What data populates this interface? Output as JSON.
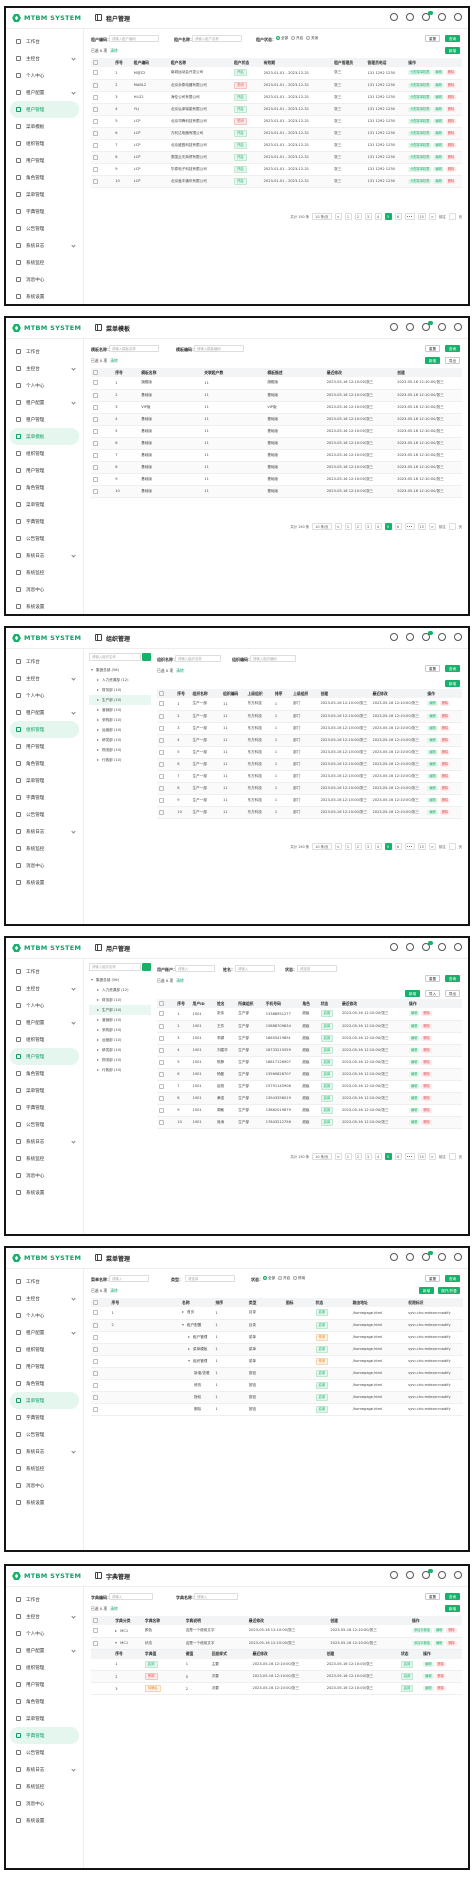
{
  "brand": "MTBM SYSTEM",
  "colors": {
    "accent": "#17b26a",
    "danger": "#e5484d",
    "active_bg": "#e5f6ee"
  },
  "sidebars": {
    "tenant_menu": [
      {
        "label": "工作台"
      },
      {
        "label": "主控台",
        "caret": true
      },
      {
        "label": "个人中心"
      },
      {
        "label": "租户配置",
        "caret": true
      },
      {
        "label": "租户管理"
      },
      {
        "label": "菜单模板"
      },
      {
        "label": "组织管理"
      },
      {
        "label": "用户管理"
      },
      {
        "label": "角色管理"
      },
      {
        "label": "菜单管理"
      },
      {
        "label": "字典管理"
      },
      {
        "label": "公告管理"
      },
      {
        "label": "系统日志",
        "caret": true
      },
      {
        "label": "系统监控"
      },
      {
        "label": "消息中心"
      },
      {
        "label": "系统设置"
      }
    ],
    "main_menu": [
      {
        "label": "工作台"
      },
      {
        "label": "主控台",
        "caret": true
      },
      {
        "label": "个人中心"
      },
      {
        "label": "租户配置",
        "caret": true
      },
      {
        "label": "组织管理"
      },
      {
        "label": "用户管理"
      },
      {
        "label": "角色管理"
      },
      {
        "label": "菜单管理"
      },
      {
        "label": "字典管理"
      },
      {
        "label": "公告管理"
      },
      {
        "label": "系统日志",
        "caret": true
      },
      {
        "label": "系统监控"
      },
      {
        "label": "消息中心"
      },
      {
        "label": "系统设置"
      }
    ]
  },
  "common": {
    "expand_label": "已选 0 项",
    "clear_label": "清除",
    "total_label": "共计 150 条",
    "page_size": "10 条/页",
    "goto_label": "前往",
    "page_suffix": "页",
    "query_btn": "查询",
    "reset_btn": "重置",
    "add_btn": "新增",
    "import_btn": "导入",
    "export_btn": "导出",
    "expand_all_btn": "展开/折叠"
  },
  "pager_pages": [
    "<",
    "1",
    "2",
    "3",
    "4",
    "5",
    "6",
    "•••",
    "15",
    ">"
  ],
  "panel1": {
    "title": "租户管理",
    "filters": {
      "code_label": "租户编码：",
      "code_ph": "请输入租户编码",
      "name_label": "租户名称：",
      "name_ph": "请输入租户名称",
      "status_label": "租户状态：",
      "radio_all": "全部",
      "radio_on": "开启",
      "radio_off": "关闭"
    },
    "columns": [
      "序号",
      "租户编码",
      "租户名称",
      "租户状态",
      "有效期",
      "租户管理员",
      "管理员电话",
      "操作"
    ],
    "rows": [
      [
        "1",
        "M@Z2",
        "南城运动会开发公司",
        "开启",
        "2023-01-01 - 2023-12-31",
        "张三",
        "131 1292 1230"
      ],
      [
        "2",
        "MABL2",
        "北京永泰电器有限公司",
        "关闭",
        "2023-01-01 - 2023-12-31",
        "张三",
        "131 1292 1230"
      ],
      [
        "3",
        "HLG2",
        "海伦公司有限公司",
        "开启",
        "2023-01-01 - 2023-12-31",
        "张三",
        "131 1292 1230"
      ],
      [
        "4",
        "YLJ",
        "北京弘泽瑞能有限公司",
        "开启",
        "2023-01-01 - 2023-12-31",
        "张三",
        "131 1292 1230"
      ],
      [
        "5",
        "LCP",
        "北京华腾科技有限公司",
        "关闭",
        "2023-01-01 - 2023-12-31",
        "张三",
        "131 1292 1230"
      ],
      [
        "6",
        "LCP",
        "万利达电器有限公司",
        "开启",
        "2023-01-01 - 2023-12-31",
        "张三",
        "131 1292 1230"
      ],
      [
        "7",
        "LCP",
        "北京盛昌科技有限公司",
        "开启",
        "2023-01-01 - 2023-12-31",
        "张三",
        "131 1292 1230"
      ],
      [
        "8",
        "LCP",
        "泰国云天商贸有限公司",
        "开启",
        "2023-01-01 - 2023-12-31",
        "张三",
        "131 1292 1230"
      ],
      [
        "9",
        "LCP",
        "华泰电子科技有限公司",
        "开启",
        "2023-01-01 - 2023-12-31",
        "张三",
        "131 1292 1230"
      ],
      [
        "10",
        "LCP",
        "北京鑫丰通讯有限公司",
        "开启",
        "2023-01-01 - 2023-12-31",
        "张三",
        "131 1292 1230"
      ]
    ],
    "actions": [
      "分配菜单权限",
      "编辑",
      "删除"
    ]
  },
  "panel2": {
    "title": "菜单模板",
    "filters": {
      "name_label": "模板名称：",
      "name_ph": "请输入模板名称",
      "code_label": "模板编码：",
      "code_ph": "请输入模板编码"
    },
    "columns": [
      "序号",
      "模板名称",
      "关联租户数",
      "模板描述",
      "最近修改",
      "创建"
    ],
    "rows": [
      [
        "1",
        "旗舰版",
        "11",
        "旗舰版",
        "2023-05-16 12:10:00/张三",
        "2023-05-16 12:10:00/张三"
      ],
      [
        "2",
        "基础版",
        "11",
        "基础版",
        "2023-05-16 12:10:00/张三",
        "2023-05-16 12:10:00/张三"
      ],
      [
        "3",
        "VIP版",
        "11",
        "VIP版",
        "2023-05-16 12:10:00/张三",
        "2023-05-16 12:10:00/张三"
      ],
      [
        "4",
        "基础版",
        "11",
        "基础版",
        "2023-05-16 12:10:00/张三",
        "2023-05-16 12:10:00/张三"
      ],
      [
        "5",
        "基础版",
        "11",
        "基础版",
        "2023-05-16 12:10:00/张三",
        "2023-05-16 12:10:00/张三"
      ],
      [
        "6",
        "基础版",
        "11",
        "基础版",
        "2023-05-16 12:10:00/张三",
        "2023-05-16 12:10:00/张三"
      ],
      [
        "7",
        "基础版",
        "11",
        "基础版",
        "2023-05-16 12:10:00/张三",
        "2023-05-16 12:10:00/张三"
      ],
      [
        "8",
        "基础版",
        "11",
        "基础版",
        "2023-05-16 12:10:00/张三",
        "2023-05-16 12:10:00/张三"
      ],
      [
        "9",
        "基础版",
        "11",
        "基础版",
        "2023-05-16 12:10:00/张三",
        "2023-05-16 12:10:00/张三"
      ],
      [
        "10",
        "基础版",
        "11",
        "基础版",
        "2023-05-16 12:10:00/张三",
        "2023-05-16 12:10:00/张三"
      ]
    ]
  },
  "org_tree": {
    "search_ph": "请输入组织名称",
    "nodes": [
      {
        "label": "集团总部 (56)",
        "level": 0,
        "open": true
      },
      {
        "label": "人力资源部 (12)",
        "level": 1
      },
      {
        "label": "财务部 (10)",
        "level": 1
      },
      {
        "label": "生产部 (10)",
        "level": 1,
        "sel": true
      },
      {
        "label": "营销部 (10)",
        "level": 1
      },
      {
        "label": "采购部 (10)",
        "level": 1
      },
      {
        "label": "运营部 (10)",
        "level": 1
      },
      {
        "label": "研发部 (10)",
        "level": 1
      },
      {
        "label": "物流部 (10)",
        "level": 1
      },
      {
        "label": "行政部 (10)",
        "level": 1
      }
    ]
  },
  "panel3": {
    "title": "组织管理",
    "filters": {
      "name_label": "组织名称：",
      "name_ph": "请输入组织名称",
      "code_label": "组织编码：",
      "code_ph": "请输入组织编码"
    },
    "columns": [
      "序号",
      "组织名称",
      "组织编码",
      "上级组织",
      "排序",
      "上级组织",
      "创建",
      "最近修改",
      "操作"
    ],
    "rows": [
      [
        "1",
        "生产一部",
        "11",
        "东方科技",
        "1",
        "部门",
        "2023-05-16 12:10:00/张三",
        "2023-05-16 12:10:00/张三"
      ],
      [
        "2",
        "生产一部",
        "11",
        "东方科技",
        "1",
        "部门",
        "2023-05-16 12:10:00/张三",
        "2023-05-16 12:10:00/张三"
      ],
      [
        "3",
        "生产一部",
        "11",
        "东方科技",
        "1",
        "部门",
        "2023-05-16 12:10:00/张三",
        "2023-05-16 12:10:00/张三"
      ],
      [
        "4",
        "生产一部",
        "11",
        "东方科技",
        "1",
        "部门",
        "2023-05-16 12:10:00/张三",
        "2023-05-16 12:10:00/张三"
      ],
      [
        "5",
        "生产一部",
        "11",
        "东方科技",
        "1",
        "部门",
        "2023-05-16 12:10:00/张三",
        "2023-05-16 12:10:00/张三"
      ],
      [
        "6",
        "生产一部",
        "11",
        "东方科技",
        "1",
        "部门",
        "2023-05-16 12:10:00/张三",
        "2023-05-16 12:10:00/张三"
      ],
      [
        "7",
        "生产一部",
        "11",
        "东方科技",
        "1",
        "部门",
        "2023-05-16 12:10:00/张三",
        "2023-05-16 12:10:00/张三"
      ],
      [
        "8",
        "生产一部",
        "11",
        "东方科技",
        "1",
        "部门",
        "2023-05-16 12:10:00/张三",
        "2023-05-16 12:10:00/张三"
      ],
      [
        "9",
        "生产一部",
        "11",
        "东方科技",
        "1",
        "部门",
        "2023-05-16 12:10:00/张三",
        "2023-05-16 12:10:00/张三"
      ],
      [
        "10",
        "生产一部",
        "11",
        "东方科技",
        "1",
        "部门",
        "2023-05-16 12:10:00/张三",
        "2023-05-16 12:10:00/张三"
      ]
    ],
    "actions": [
      "编辑",
      "删除"
    ]
  },
  "panel4": {
    "title": "用户管理",
    "filters": {
      "account_label": "用户账户：",
      "account_ph": "请输入",
      "name_label": "姓名：",
      "name_ph": "请输入",
      "status_label": "状态：",
      "status_ph": "请选择"
    },
    "columns": [
      "序号",
      "用户ID",
      "姓名",
      "所属组织",
      "手机号码",
      "角色",
      "状态",
      "最近修改",
      "操作"
    ],
    "rows": [
      [
        "1",
        "1001",
        "张伟",
        "生产部",
        "13388951277",
        "超级",
        "启用",
        "2023-05-16 12:10:00/张三"
      ],
      [
        "2",
        "1001",
        "王芳",
        "生产部",
        "15888709834",
        "超级",
        "启用",
        "2023-05-16 12:10:00/张三"
      ],
      [
        "3",
        "1001",
        "李娜",
        "生产部",
        "18655419891",
        "超级",
        "启用",
        "2023-05-16 12:10:00/张三"
      ],
      [
        "4",
        "1001",
        "刘建华",
        "生产部",
        "18733215559",
        "超级",
        "启用",
        "2023-05-16 12:10:00/张三"
      ],
      [
        "5",
        "1001",
        "陈静",
        "生产部",
        "16817128907",
        "超级",
        "启用",
        "2023-05-16 12:10:00/张三"
      ],
      [
        "6",
        "1001",
        "杨磊",
        "生产部",
        "13569828707",
        "超级",
        "启用",
        "2023-05-16 12:10:00/张三"
      ],
      [
        "7",
        "1001",
        "赵丽",
        "生产部",
        "15791145906",
        "超级",
        "启用",
        "2023-05-16 12:10:00/张三"
      ],
      [
        "8",
        "1001",
        "黄强",
        "生产部",
        "13943358019",
        "超级",
        "启用",
        "2023-05-16 12:10:00/张三"
      ],
      [
        "9",
        "1001",
        "周敏",
        "生产部",
        "13862019879",
        "超级",
        "启用",
        "2023-05-16 12:10:00/张三"
      ],
      [
        "10",
        "1001",
        "吴涛",
        "生产部",
        "17643212756",
        "超级",
        "启用",
        "2023-05-16 12:10:00/张三"
      ]
    ],
    "actions": [
      "编辑",
      "删除"
    ]
  },
  "panel5": {
    "title": "菜单管理",
    "filters": {
      "name_label": "菜单名称：",
      "name_ph": "请输入",
      "type_label": "类型：",
      "type_ph": "请选择",
      "status_label": "状态：",
      "radio_all": "全部",
      "radio_on": "开启",
      "radio_off": "停用"
    },
    "columns": [
      "序号",
      "名称",
      "排序",
      "类型",
      "图标",
      "状态",
      "路由地址",
      "权限标识",
      "操作"
    ],
    "rows": [
      {
        "seq": "1",
        "indent": 0,
        "tri": "right",
        "name": "首页",
        "sort": "1",
        "type": "目录",
        "status": "启用",
        "route": "/homepage.html",
        "perm": "sys:u:hu:mdean:modify"
      },
      {
        "seq": "2",
        "indent": 0,
        "tri": "down",
        "name": "租户配置",
        "sort": "1",
        "type": "目录",
        "status": "启用",
        "route": "/homepage.html",
        "perm": "sys:u:hu:mdean:modify"
      },
      {
        "seq": "",
        "indent": 1,
        "tri": "right",
        "name": "租户管理",
        "sort": "1",
        "type": "菜单",
        "status": "停用",
        "route": "/homepage.html",
        "perm": "sys:u:hu:mdean:modify"
      },
      {
        "seq": "",
        "indent": 1,
        "tri": "right",
        "name": "菜单模板",
        "sort": "1",
        "type": "菜单",
        "status": "启用",
        "route": "/homepage.html",
        "perm": "sys:u:hu:mdean:modify"
      },
      {
        "seq": "",
        "indent": 1,
        "tri": "down",
        "name": "组织管理",
        "sort": "1",
        "type": "菜单",
        "status": "停用",
        "route": "/homepage.html",
        "perm": "sys:u:hu:mdean:modify"
      },
      {
        "seq": "",
        "indent": 2,
        "tri": "",
        "name": "新增/查看",
        "sort": "1",
        "type": "按钮",
        "status": "启用",
        "route": "/homepage.html",
        "perm": "sys:u:hu:mdean:modify"
      },
      {
        "seq": "",
        "indent": 2,
        "tri": "",
        "name": "修改",
        "sort": "1",
        "type": "按钮",
        "status": "启用",
        "route": "/homepage.html",
        "perm": "sys:u:hu:mdean:modify"
      },
      {
        "seq": "",
        "indent": 2,
        "tri": "",
        "name": "授权",
        "sort": "1",
        "type": "按钮",
        "status": "启用",
        "route": "/homepage.html",
        "perm": "sys:u:hu:mdean:modify"
      },
      {
        "seq": "",
        "indent": 2,
        "tri": "",
        "name": "删除",
        "sort": "1",
        "type": "按钮",
        "status": "启用",
        "route": "/homepage.html",
        "perm": "sys:u:hu:mdean:modify"
      }
    ],
    "actions": [
      "编辑",
      "删除"
    ]
  },
  "panel6": {
    "title": "字典管理",
    "filters": {
      "code_label": "字典编码：",
      "code_ph": "请输入",
      "name_label": "字典名称：",
      "name_ph": "请输入"
    },
    "columns": [
      "字典分类",
      "字典名称",
      "字典说明",
      "最近修改",
      "创建",
      "操作"
    ],
    "rows": [
      [
        "MC1",
        "颜色",
        "这是一个使用文字",
        "2023-05-16 12:10:00/张三",
        "2023-05-16 12:10:00/张三"
      ],
      [
        "MC1",
        "状态",
        "这是一个使用文字",
        "2023-05-16 12:10:00/张三",
        "2023-05-16 12:10:00/张三"
      ]
    ],
    "sub_columns": [
      "序号",
      "字典值",
      "键值",
      "回显样式",
      "最近修改",
      "创建",
      "状态",
      "操作"
    ],
    "sub_rows": [
      [
        "1",
        "启用",
        "1",
        "主要",
        "2023-05-16 12:10:00/张三",
        "2023-05-16 12:10:00/张三",
        "启用"
      ],
      [
        "2",
        "停用",
        "0",
        "次要",
        "2023-05-16 12:10:00/张三",
        "2023-05-16 12:10:00/张三",
        "启用"
      ],
      [
        "3",
        "待确认",
        "2",
        "次要",
        "2023-05-16 12:10:00/张三",
        "2023-05-16 12:10:00/张三",
        "启用"
      ]
    ],
    "actions": [
      "添加字典值",
      "编辑",
      "删除"
    ]
  }
}
